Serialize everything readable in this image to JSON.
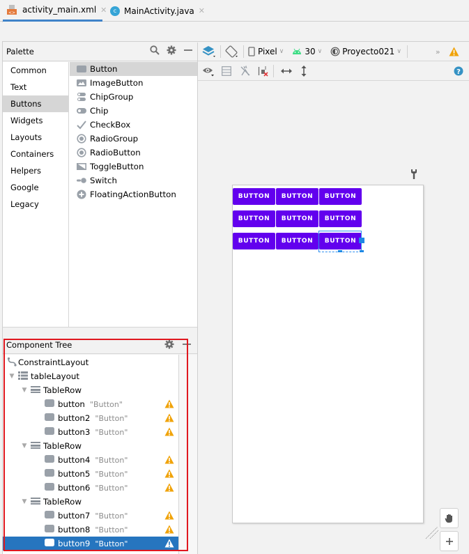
{
  "tabs": [
    {
      "label": "activity_main.xml",
      "icon": "xml-file-icon",
      "active": true
    },
    {
      "label": "MainActivity.java",
      "icon": "java-class-icon",
      "active": false
    }
  ],
  "palette": {
    "title": "Palette",
    "categories": [
      "Common",
      "Text",
      "Buttons",
      "Widgets",
      "Layouts",
      "Containers",
      "Helpers",
      "Google",
      "Legacy"
    ],
    "selected_category": "Buttons",
    "items": [
      {
        "label": "Button",
        "icon": "button-icon"
      },
      {
        "label": "ImageButton",
        "icon": "image-button-icon"
      },
      {
        "label": "ChipGroup",
        "icon": "chip-group-icon"
      },
      {
        "label": "Chip",
        "icon": "chip-icon"
      },
      {
        "label": "CheckBox",
        "icon": "checkbox-icon"
      },
      {
        "label": "RadioGroup",
        "icon": "radio-group-icon"
      },
      {
        "label": "RadioButton",
        "icon": "radio-button-icon"
      },
      {
        "label": "ToggleButton",
        "icon": "toggle-button-icon"
      },
      {
        "label": "Switch",
        "icon": "switch-icon"
      },
      {
        "label": "FloatingActionButton",
        "icon": "fab-icon"
      }
    ],
    "selected_item": "Button"
  },
  "toolbar": {
    "device": "Pixel",
    "api": "30",
    "theme": "Proyecto021",
    "overflow": "»"
  },
  "component_tree": {
    "title": "Component Tree",
    "nodes": [
      {
        "label": "ConstraintLayout",
        "text": "",
        "type": "constraint",
        "warn": false
      },
      {
        "label": "tableLayout",
        "text": "",
        "type": "table",
        "warn": false
      },
      {
        "label": "TableRow",
        "text": "",
        "type": "row",
        "warn": false
      },
      {
        "label": "button",
        "text": "\"Button\"",
        "type": "button",
        "warn": true
      },
      {
        "label": "button2",
        "text": "\"Button\"",
        "type": "button",
        "warn": true
      },
      {
        "label": "button3",
        "text": "\"Button\"",
        "type": "button",
        "warn": true
      },
      {
        "label": "TableRow",
        "text": "",
        "type": "row",
        "warn": false
      },
      {
        "label": "button4",
        "text": "\"Button\"",
        "type": "button",
        "warn": true
      },
      {
        "label": "button5",
        "text": "\"Button\"",
        "type": "button",
        "warn": true
      },
      {
        "label": "button6",
        "text": "\"Button\"",
        "type": "button",
        "warn": true
      },
      {
        "label": "TableRow",
        "text": "",
        "type": "row",
        "warn": false
      },
      {
        "label": "button7",
        "text": "\"Button\"",
        "type": "button",
        "warn": true
      },
      {
        "label": "button8",
        "text": "\"Button\"",
        "type": "button",
        "warn": true
      },
      {
        "label": "button9",
        "text": "\"Button\"",
        "type": "button",
        "warn": true
      }
    ],
    "selected": "button9"
  },
  "design": {
    "button_label": "BUTTON",
    "rows": 3,
    "cols": 3,
    "selected_button": "button9",
    "button_color": "#6200ee"
  },
  "colors": {
    "accent": "#2675bf",
    "warning": "#f0a30a",
    "highlight_box": "#e0181f"
  }
}
